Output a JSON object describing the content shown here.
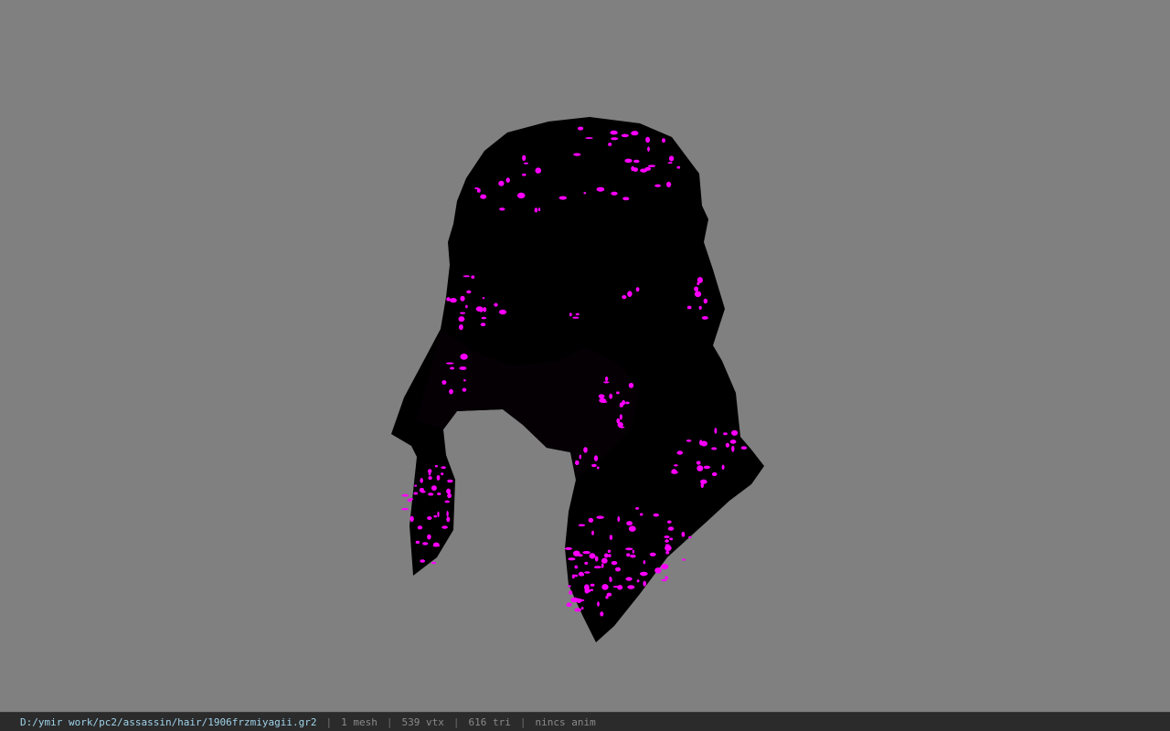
{
  "viewer": {
    "background_color": "#808080",
    "model": {
      "base_color": "#000000",
      "speckle_color": "#ff00ff",
      "icon": "hair-mesh-model"
    }
  },
  "statusbar": {
    "file_path": "D:/ymir work/pc2/assassin/hair/1906frzmiyagii.gr2",
    "separator": "|",
    "mesh_count": "1 mesh",
    "vertex_count": "539 vtx",
    "triangle_count": "616 tri",
    "anim_status": "nincs anim"
  }
}
